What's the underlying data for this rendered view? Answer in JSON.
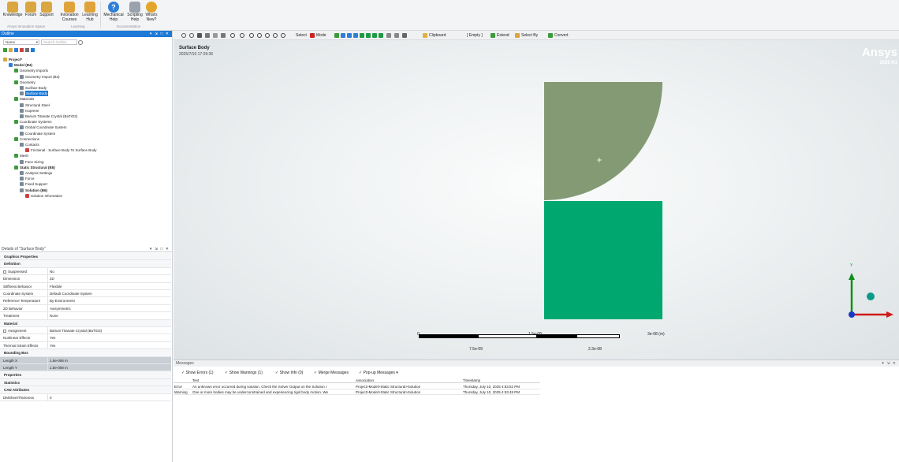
{
  "ribbon": {
    "buttons": [
      {
        "label": "Knowledge",
        "icon": "knowledge-icon"
      },
      {
        "label": "Forum",
        "icon": "forum-icon"
      },
      {
        "label": "Support",
        "icon": "support-icon"
      },
      {
        "label": "Innovation\nCourses",
        "icon": "courses-icon"
      },
      {
        "label": "Learning\nHub",
        "icon": "learning-hub-icon"
      },
      {
        "label": "Mechanical\nHelp",
        "icon": "help-icon"
      },
      {
        "label": "Scripting\nHelp",
        "icon": "scripting-help-icon"
      },
      {
        "label": "What's\nNew?",
        "icon": "whats-new-icon"
      }
    ],
    "groups": [
      "Ansys Innovation Space",
      "Learning",
      "Documentation"
    ]
  },
  "outline": {
    "title": "Outline",
    "name_dropdown": "Name",
    "search_placeholder": "Search Outline",
    "tree": [
      {
        "label": "Project*",
        "level": 0,
        "bold": true
      },
      {
        "label": "Model (B4)",
        "level": 1,
        "bold": true
      },
      {
        "label": "Geometry Imports",
        "level": 2
      },
      {
        "label": "Geometry Import (B3)",
        "level": 3
      },
      {
        "label": "Geometry",
        "level": 2
      },
      {
        "label": "Surface Body",
        "level": 3
      },
      {
        "label": "Surface Body",
        "level": 3,
        "selected": true
      },
      {
        "label": "Materials",
        "level": 2
      },
      {
        "label": "Structural Steel",
        "level": 3
      },
      {
        "label": "Isoprene",
        "level": 3
      },
      {
        "label": "Barium Titanate Crystal (BaTiO3)",
        "level": 3
      },
      {
        "label": "Coordinate Systems",
        "level": 2
      },
      {
        "label": "Global Coordinate System",
        "level": 3
      },
      {
        "label": "Coordinate System",
        "level": 3
      },
      {
        "label": "Connections",
        "level": 2
      },
      {
        "label": "Contacts",
        "level": 3
      },
      {
        "label": "Frictional - Surface Body To Surface Body",
        "level": 4
      },
      {
        "label": "Mesh",
        "level": 2
      },
      {
        "label": "Face Sizing",
        "level": 3
      },
      {
        "label": "Static Structural (B5)",
        "level": 2,
        "bold": true
      },
      {
        "label": "Analysis Settings",
        "level": 3
      },
      {
        "label": "Force",
        "level": 3
      },
      {
        "label": "Fixed Support",
        "level": 3
      },
      {
        "label": "Solution (B6)",
        "level": 3,
        "bold": true
      },
      {
        "label": "Solution Information",
        "level": 4
      }
    ]
  },
  "details": {
    "title": "Details of \"Surface Body\"",
    "rows": [
      {
        "type": "group",
        "key": "Graphics Properties"
      },
      {
        "type": "group",
        "key": "Definition"
      },
      {
        "key": "Suppressed",
        "value": "No",
        "checkbox": true
      },
      {
        "key": "Dimension",
        "value": "2D"
      },
      {
        "key": "Stiffness Behavior",
        "value": "Flexible"
      },
      {
        "key": "Coordinate System",
        "value": "Default Coordinate System"
      },
      {
        "key": "Reference Temperature",
        "value": "By Environment"
      },
      {
        "key": "2D Behavior",
        "value": "Axisymmetric"
      },
      {
        "key": "Treatment",
        "value": "None"
      },
      {
        "type": "group",
        "key": "Material"
      },
      {
        "key": "Assignment",
        "value": "Barium Titanate Crystal (BaTiO3)",
        "checkbox": true
      },
      {
        "key": "Nonlinear Effects",
        "value": "Yes"
      },
      {
        "key": "Thermal Strain Effects",
        "value": "Yes"
      },
      {
        "type": "group",
        "key": "Bounding Box"
      },
      {
        "key": "Length X",
        "value": "1.5e-008 m",
        "highlight": true
      },
      {
        "key": "Length Y",
        "value": "1.5e-008 m",
        "highlight": true
      },
      {
        "type": "group",
        "key": "Properties"
      },
      {
        "type": "group",
        "key": "Statistics"
      },
      {
        "type": "group",
        "key": "CAD Attributes"
      },
      {
        "key": "DMSheetThickness",
        "value": "0"
      }
    ]
  },
  "toolbar": {
    "select": "Select",
    "mode": "Mode",
    "clipboard": "Clipboard",
    "empty": "[ Empty ]",
    "extend": "Extend",
    "select_by": "Select By",
    "convert": "Convert"
  },
  "viewport": {
    "title": "Surface Body",
    "timestamp": "2025/7/10 17:29:36",
    "logo": "Ansys",
    "version": "2025 R1",
    "scale": {
      "left": "0",
      "mid": "1.5e-08",
      "right": "3e-08 (m)",
      "sub1": "7.5e-09",
      "sub2": "2.3e-08"
    },
    "triad_label": "Y",
    "colors": {
      "quarter_disk": "#849a74",
      "square": "#00a870",
      "axis_y": "#109018",
      "axis_x": "#d01818",
      "axis_z": "#1838c8"
    }
  },
  "messages": {
    "title": "Messages",
    "filters": [
      "Show Errors (1)",
      "Show Warnings (1)",
      "Show Info (0)",
      "Merge Messages",
      "Pop-up Messages"
    ],
    "columns": [
      "Text",
      "Association",
      "Timestamp"
    ],
    "rows": [
      {
        "type": "Error",
        "text": "An unknown error occurred during solution. Check the Solver Output on the Solution I",
        "assoc": "Project>Model>Static Structural>Solution",
        "time": "Thursday, July 10, 2025 4:53:52 PM"
      },
      {
        "type": "Warning",
        "text": "One or more bodies may be underconstrained and experiencing rigid body motion. We",
        "assoc": "Project>Model>Static Structural>Solution",
        "time": "Thursday, July 10, 2025 4:53:48 PM"
      }
    ]
  }
}
